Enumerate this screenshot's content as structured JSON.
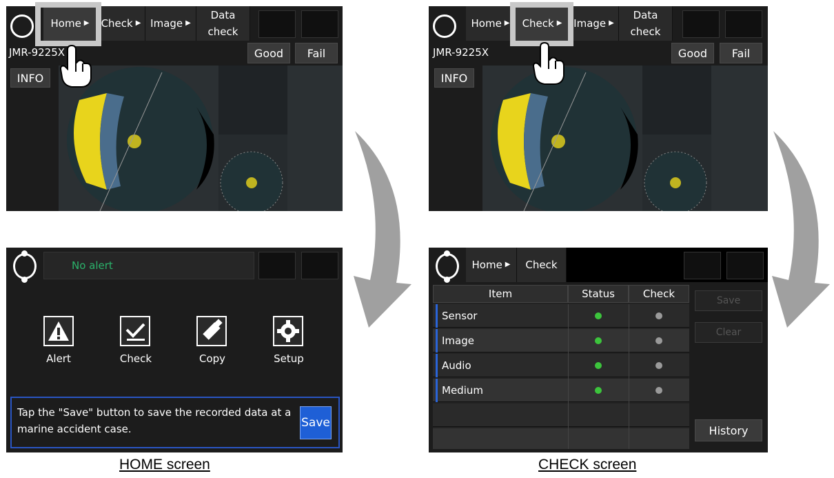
{
  "top_left": {
    "tabs": {
      "home": "Home",
      "check": "Check",
      "image": "Image",
      "data_check_1": "Data",
      "data_check_2": "check"
    },
    "device": "JMR-9225X",
    "good": "Good",
    "fail": "Fail",
    "info": "INFO"
  },
  "top_right": {
    "tabs": {
      "home": "Home",
      "check": "Check",
      "image": "Image",
      "data_check_1": "Data",
      "data_check_2": "check"
    },
    "device": "JMR-9225X",
    "good": "Good",
    "fail": "Fail",
    "info": "INFO"
  },
  "home_screen": {
    "alert_status": "No alert",
    "icons": [
      {
        "label": "Alert",
        "icon": "warning-icon"
      },
      {
        "label": "Check",
        "icon": "checkmark-icon"
      },
      {
        "label": "Copy",
        "icon": "usb-drive-icon"
      },
      {
        "label": "Setup",
        "icon": "gear-icon"
      }
    ],
    "message": "Tap the \"Save\" button to save the recorded data at a marine accident case.",
    "save": "Save",
    "caption": "HOME screen"
  },
  "check_screen": {
    "breadcrumb": {
      "home": "Home",
      "check": "Check"
    },
    "columns": [
      "Item",
      "Status",
      "Check"
    ],
    "rows": [
      {
        "item": "Sensor",
        "status": "green",
        "check": "gray"
      },
      {
        "item": "Image",
        "status": "green",
        "check": "gray"
      },
      {
        "item": "Audio",
        "status": "green",
        "check": "gray"
      },
      {
        "item": "Medium",
        "status": "green",
        "check": "gray"
      }
    ],
    "save": "Save",
    "clear": "Clear",
    "history": "History",
    "caption": "CHECK screen"
  },
  "colors": {
    "screen_bg": "#1c1c1c",
    "highlight": "#c8c8c8",
    "status_green": "#3cc43c",
    "check_gray": "#9a9a9a",
    "save_blue": "#1e5fd6",
    "radar_yellow": "#e8d41c",
    "arrow_gray": "#a0a0a0"
  }
}
